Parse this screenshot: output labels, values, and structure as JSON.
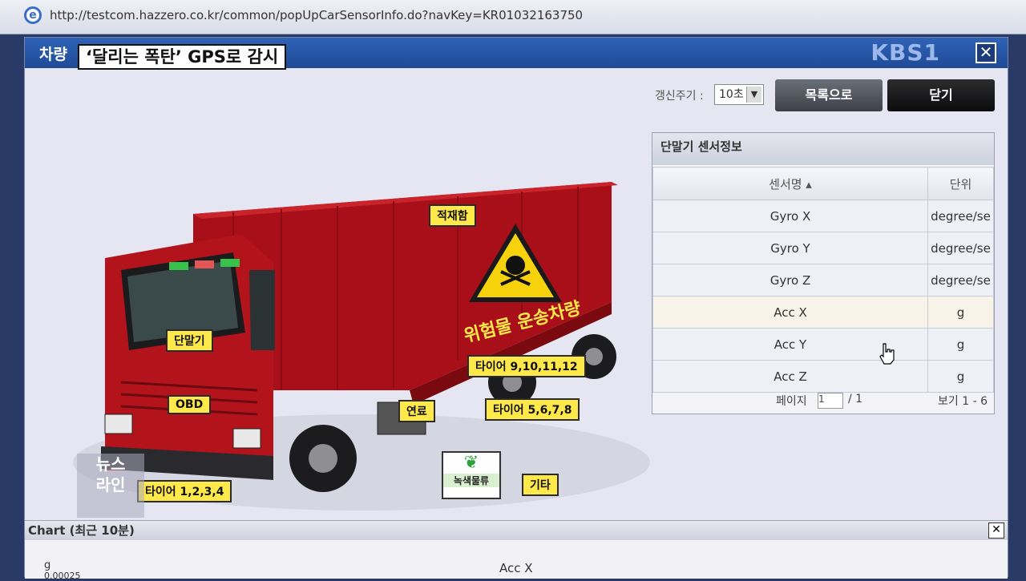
{
  "browser": {
    "url": "http://testcom.hazzero.co.kr/common/popUpCarSensorInfo.do?navKey=KR01032163750"
  },
  "window": {
    "title": "차량",
    "caption": "‘달리는 폭탄’ GPS로 감시",
    "broadcaster": "KBS1"
  },
  "controls": {
    "refresh_label": "갱신주기 :",
    "refresh_value": "10초",
    "list_button": "목록으로",
    "close_button": "닫기"
  },
  "truck": {
    "hazard_text": "위험물 운송차량",
    "labels": {
      "cargo": "적재함",
      "terminal": "단말기",
      "obd": "OBD",
      "fuel": "연료",
      "tire_9_12": "타이어 9,10,11,12",
      "tire_5_8": "타이어 5,6,7,8",
      "tire_1_4": "타이어 1,2,3,4",
      "green_logistics": "녹색물류",
      "other": "기타"
    }
  },
  "sensor_panel": {
    "title": "단말기 센서정보",
    "columns": [
      "센서명 ▴",
      "단위"
    ],
    "rows": [
      {
        "name": "Gyro X",
        "unit": "degree/se"
      },
      {
        "name": "Gyro Y",
        "unit": "degree/se"
      },
      {
        "name": "Gyro Z",
        "unit": "degree/se"
      },
      {
        "name": "Acc X",
        "unit": "g"
      },
      {
        "name": "Acc Y",
        "unit": "g"
      },
      {
        "name": "Acc Z",
        "unit": "g"
      }
    ],
    "pager": {
      "page_label": "페이지",
      "page_value": "1",
      "page_total": "/ 1",
      "view_label": "보기 1 - 6"
    }
  },
  "chart_panel": {
    "title": "Chart (최근 10분)",
    "chart_title": "Acc X",
    "y_unit": "g",
    "y_value": "0.00025"
  },
  "watermark": {
    "line1": "뉴스",
    "line2": "라인"
  },
  "colors": {
    "titlebar": "#2f63b7",
    "label_bg": "#ffe84a",
    "truck_red": "#b3131b"
  }
}
